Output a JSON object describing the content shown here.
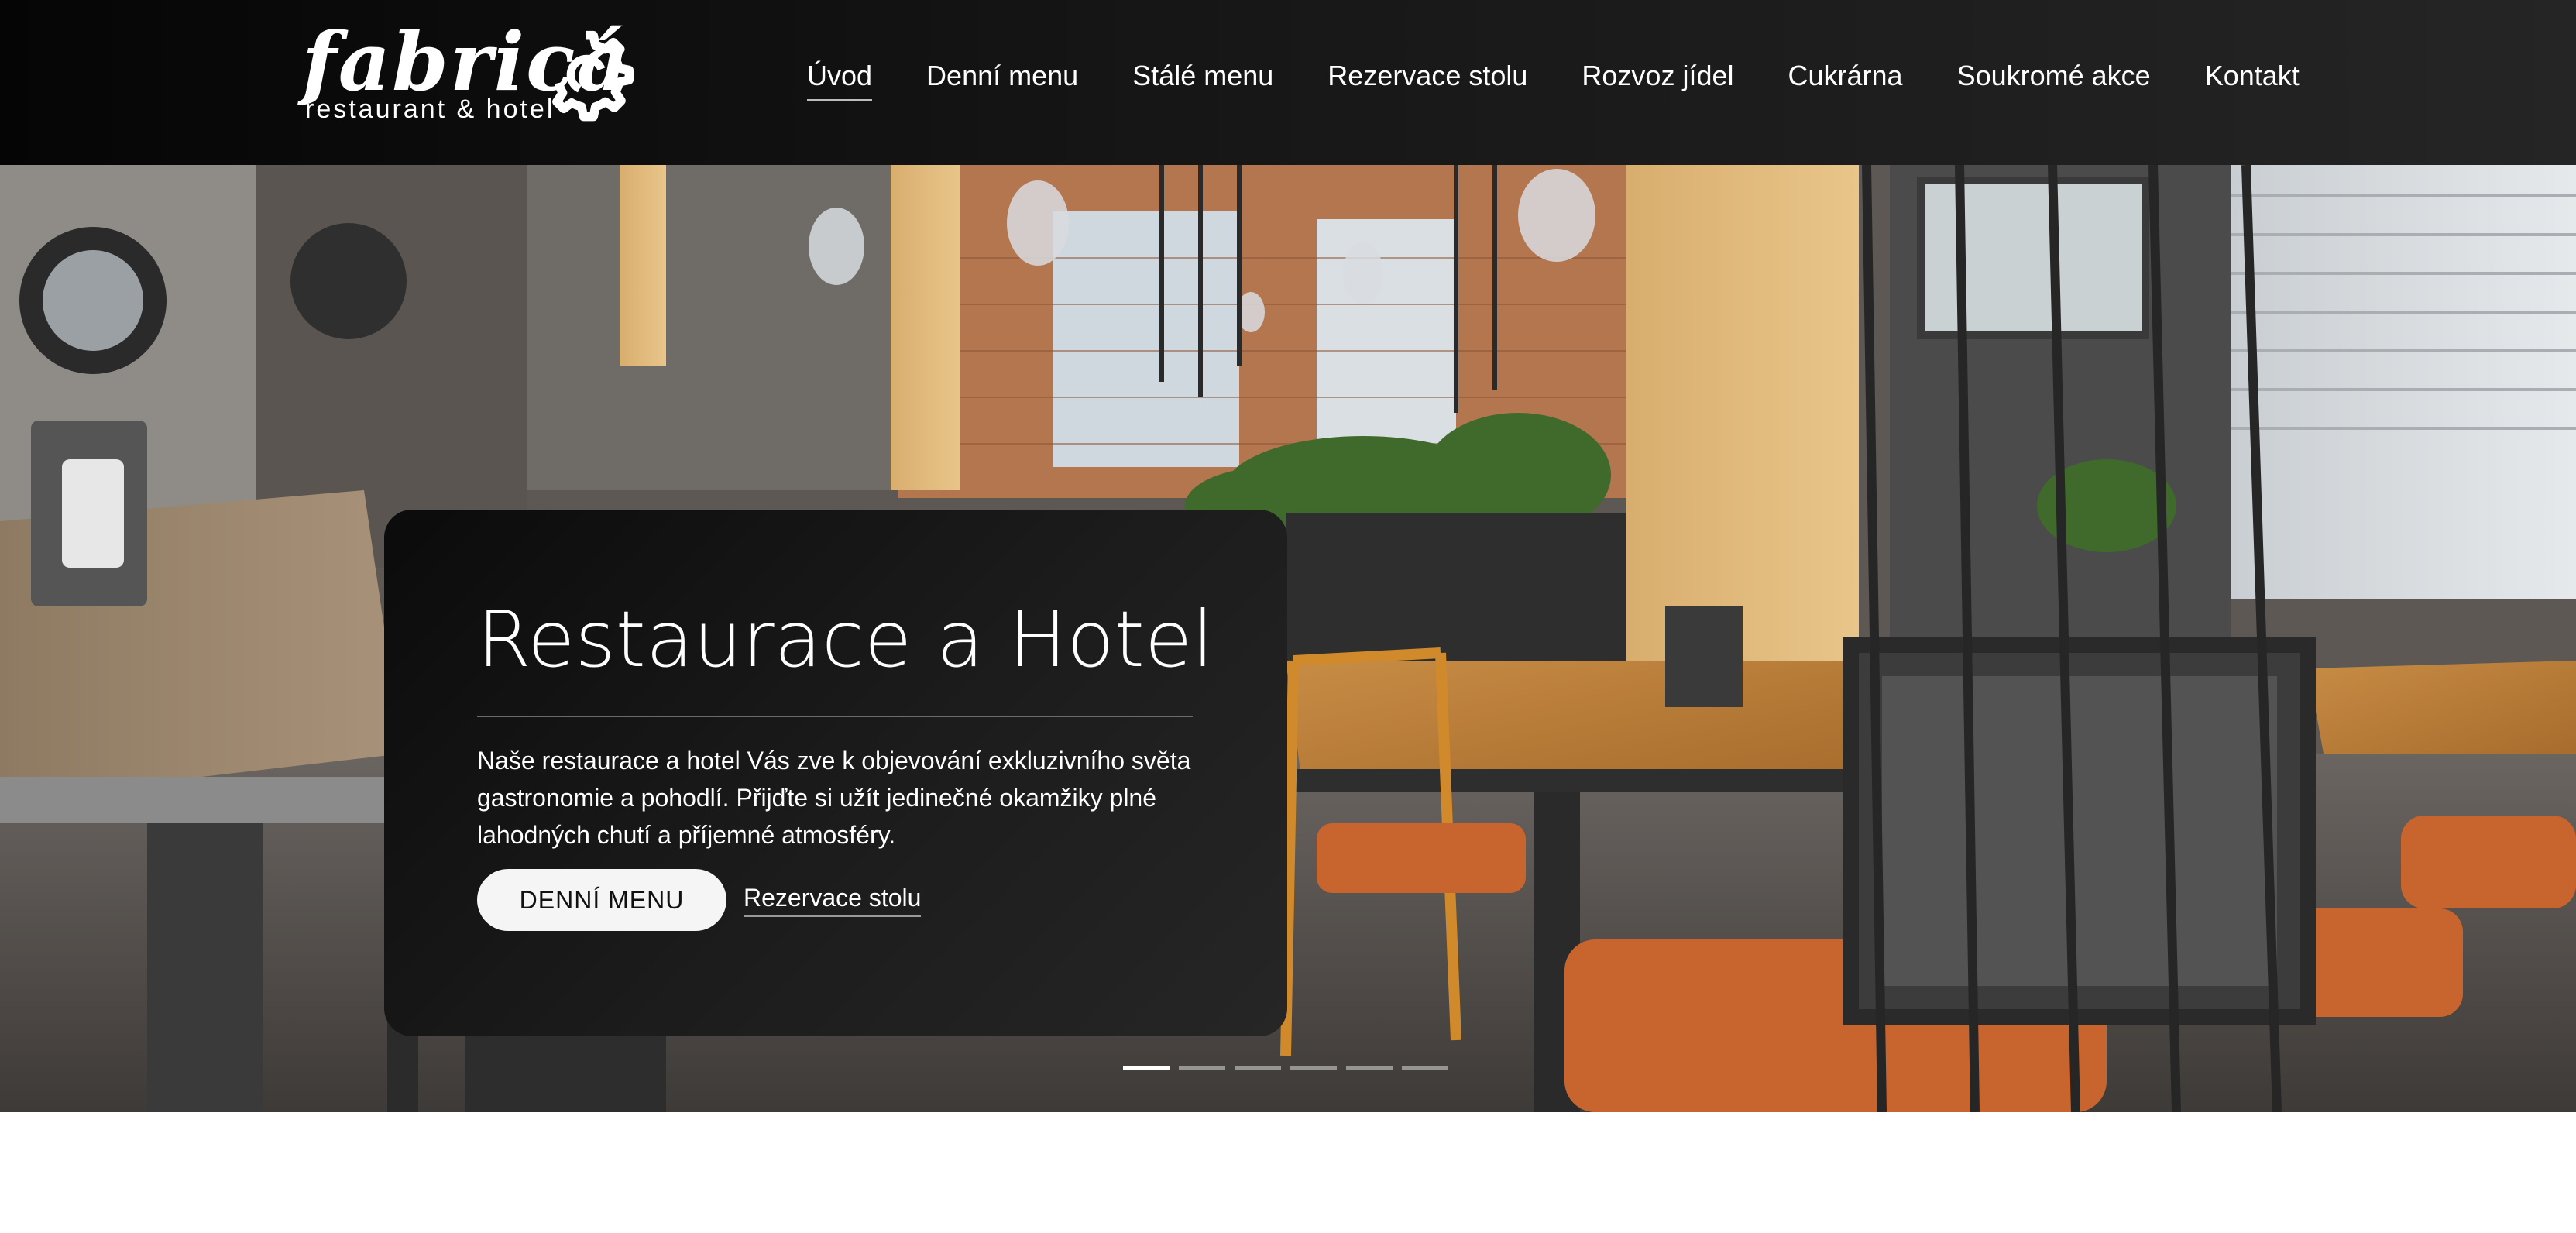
{
  "brand": {
    "name": "fabricá",
    "tagline": "restaurant & hotel"
  },
  "nav": {
    "items": [
      {
        "label": "Úvod",
        "active": true
      },
      {
        "label": "Denní menu",
        "active": false
      },
      {
        "label": "Stálé menu",
        "active": false
      },
      {
        "label": "Rezervace stolu",
        "active": false
      },
      {
        "label": "Rozvoz jídel",
        "active": false
      },
      {
        "label": "Cukrárna",
        "active": false
      },
      {
        "label": "Soukromé akce",
        "active": false
      },
      {
        "label": "Kontakt",
        "active": false
      }
    ]
  },
  "hero": {
    "title": "Restaurace a Hotel",
    "text": "Naše restaurace a hotel Vás zve k objevování exkluzivního světa gastronomie a pohodlí. Přijďte si užít jedinečné okamžiky plné lahodných chutí a příjemné atmosféry.",
    "primary_button": "DENNÍ MENU",
    "secondary_link": "Rezervace stolu",
    "slides": {
      "count": 6,
      "active_index": 0
    }
  },
  "colors": {
    "header_bg": "#111111",
    "card_bg": "#1a1a1a",
    "button_bg": "#f5f5f5",
    "accent_orange": "#c8652f"
  },
  "icons": {
    "logo_gear": "gear-icon"
  }
}
